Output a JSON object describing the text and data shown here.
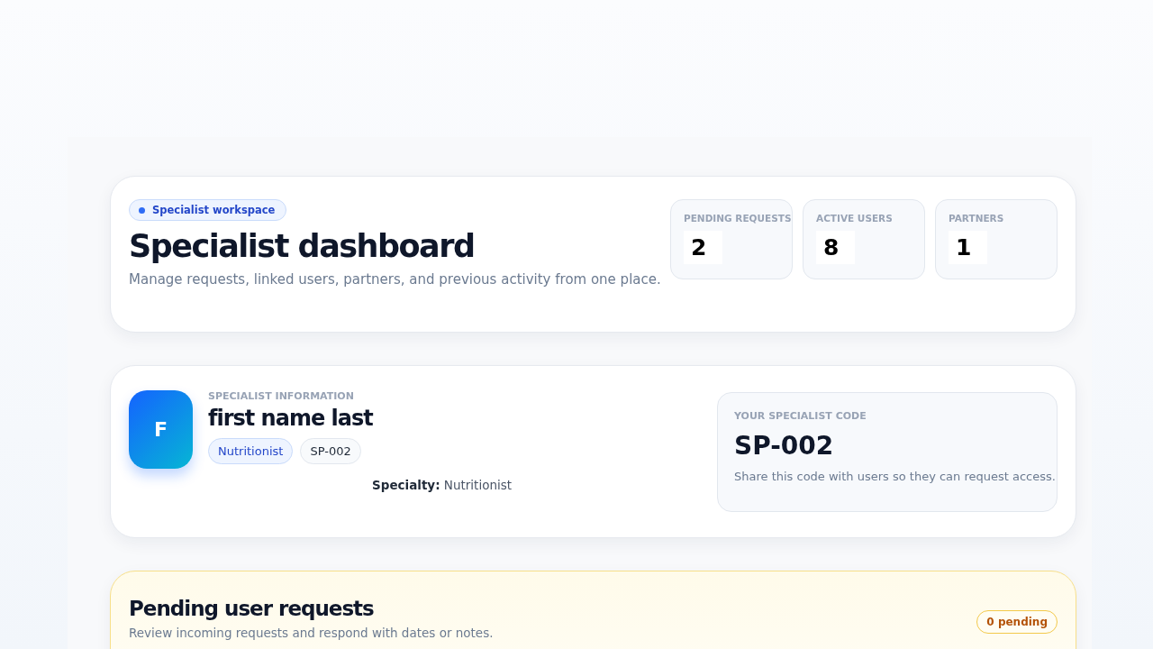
{
  "header": {
    "badge": "Specialist workspace",
    "title": "Specialist dashboard",
    "subtitle": "Manage requests, linked users, partners, and previous activity from one place.",
    "stats": [
      {
        "label": "PENDING REQUESTS",
        "value": "2"
      },
      {
        "label": "ACTIVE USERS",
        "value": "8"
      },
      {
        "label": "PARTNERS",
        "value": "1"
      }
    ]
  },
  "profile": {
    "avatar": "F",
    "section_label": "SPECIALIST INFORMATION",
    "name": "first name last",
    "tags": [
      {
        "text": "Nutritionist",
        "kind": "primary"
      },
      {
        "text": "SP-002",
        "kind": "neutral"
      }
    ],
    "specialty_label": "Specialty:",
    "specialty": "Nutritionist",
    "code_card": {
      "label": "YOUR SPECIALIST CODE",
      "code": "SP-002",
      "hint": "Share this code with users so they can request access."
    }
  },
  "pending": {
    "title": "Pending user requests",
    "subtitle": "Review incoming requests and respond with dates or notes.",
    "count": "0 pending"
  }
}
